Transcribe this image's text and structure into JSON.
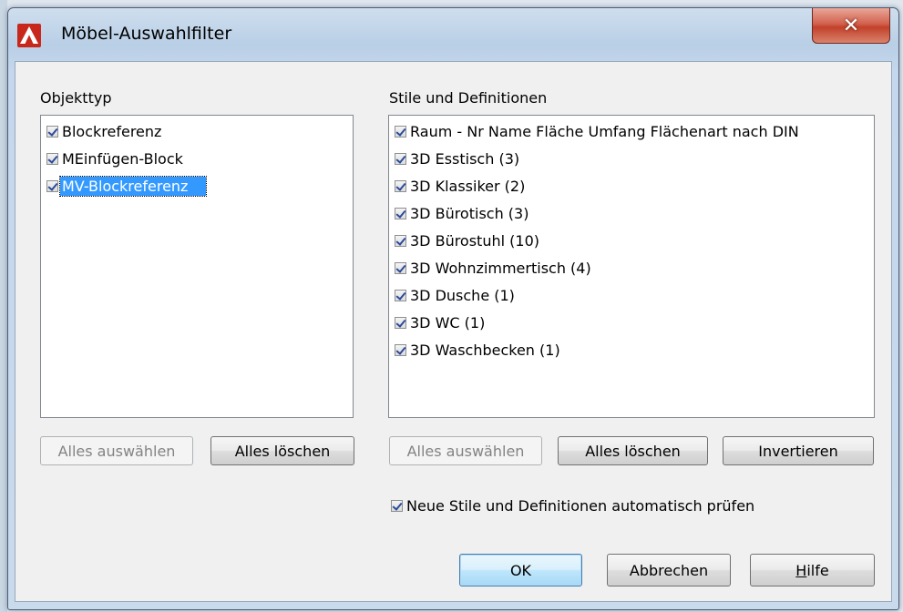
{
  "window": {
    "title": "Möbel-Auswahlfilter",
    "close_symbol": "✕",
    "icon": "autocad-a-icon",
    "accent_color": "#c7281b"
  },
  "left_panel": {
    "heading": "Objekttyp",
    "items": [
      {
        "label": "Blockreferenz",
        "checked": true
      },
      {
        "label": "MEinfügen-Block",
        "checked": true
      },
      {
        "label": "MV-Blockreferenz",
        "checked": true,
        "selected": true
      }
    ],
    "select_all_label": "Alles auswählen",
    "clear_all_label": "Alles löschen"
  },
  "right_panel": {
    "heading": "Stile und Definitionen",
    "items": [
      {
        "label": "Raum - Nr Name Fläche Umfang Flächenart nach DIN",
        "checked": true
      },
      {
        "label": "3D Esstisch (3)",
        "checked": true
      },
      {
        "label": "3D Klassiker (2)",
        "checked": true
      },
      {
        "label": "3D Bürotisch (3)",
        "checked": true
      },
      {
        "label": "3D Bürostuhl (10)",
        "checked": true
      },
      {
        "label": "3D Wohnzimmertisch (4)",
        "checked": true
      },
      {
        "label": "3D Dusche (1)",
        "checked": true
      },
      {
        "label": "3D WC (1)",
        "checked": true
      },
      {
        "label": "3D Waschbecken (1)",
        "checked": true
      }
    ],
    "select_all_label": "Alles auswählen",
    "clear_all_label": "Alles löschen",
    "invert_label": "Invertieren"
  },
  "auto_check": {
    "label": "Neue Stile und Definitionen automatisch prüfen",
    "checked": true
  },
  "footer": {
    "ok_label": "OK",
    "cancel_label": "Abbrechen",
    "help_label_underlined": "H",
    "help_label_rest": "ilfe"
  }
}
